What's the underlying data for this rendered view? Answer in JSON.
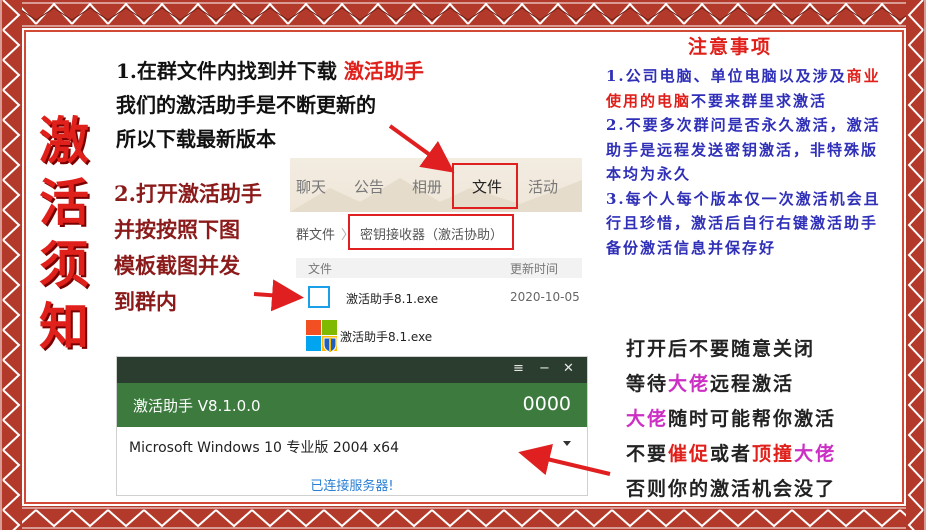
{
  "vertical_title": [
    "激",
    "活",
    "须",
    "知"
  ],
  "step1": {
    "line1_prefix": "1.在群文件内找到并下载 ",
    "line1_highlight": "激活助手",
    "line2": "我们的激活助手是不断更新的",
    "line3": "所以下载最新版本"
  },
  "step2": {
    "lines": [
      "2.打开激活助手",
      "并按按照下图",
      "模板截图并发",
      "到群内"
    ]
  },
  "group_files": {
    "tabs": [
      "聊天",
      "公告",
      "相册",
      "文件",
      "活动"
    ],
    "active_tab": "文件",
    "path_root": "群文件",
    "path_separator": "〉",
    "path_folder": "密钥接收器（激活协助）",
    "column_file": "文件",
    "column_updated": "更新时间",
    "rows": [
      {
        "name": "激活助手8.1.exe",
        "date": "2020-10-05",
        "icon": "windows-logo-icon"
      },
      {
        "name": "激活助手8.1.exe",
        "date": "",
        "icon": "windows-shield-icon"
      }
    ]
  },
  "activator": {
    "titlebar_buttons": [
      "≡",
      "−",
      "✕"
    ],
    "title": "激活助手 V8.1.0.0",
    "code": "0000",
    "os": "Microsoft Windows 10 专业版 2004 x64",
    "status": "已连接服务器!"
  },
  "notes": {
    "title": "注意事项",
    "items": [
      {
        "parts": [
          [
            "1.公司电脑、单位电脑以及涉及",
            "b"
          ],
          [
            "商业使用的电脑",
            "r"
          ],
          [
            "不要来群里求激活",
            "b"
          ]
        ]
      },
      {
        "parts": [
          [
            "2.不要多次群问是否永久激活，激活助手是远程发送密钥激活，非特殊版本均为永久",
            "b"
          ]
        ]
      },
      {
        "parts": [
          [
            "3.每个人每个版本仅一次激活机会且行且珍惜，激活后自行右键激活助手备份激活信息并保存好",
            "b"
          ]
        ]
      }
    ]
  },
  "warning": {
    "line1": "打开后不要随意关闭",
    "line2_a": "等待",
    "line2_b": "大佬",
    "line2_c": "远程激活",
    "line3_a": "大佬",
    "line3_b": "随时可能帮你激活",
    "line4_a": "不要",
    "line4_b": "催促",
    "line4_c": "或者",
    "line4_d": "顶撞",
    "line4_e": "大佬",
    "line5": "否则你的激活机会没了"
  },
  "colors": {
    "border": "#b33a2a",
    "title_red": "#e0201a",
    "notes_blue": "#2f2fb8",
    "activator_green": "#3c7a3e",
    "warning_pink": "#cc2fc4"
  }
}
